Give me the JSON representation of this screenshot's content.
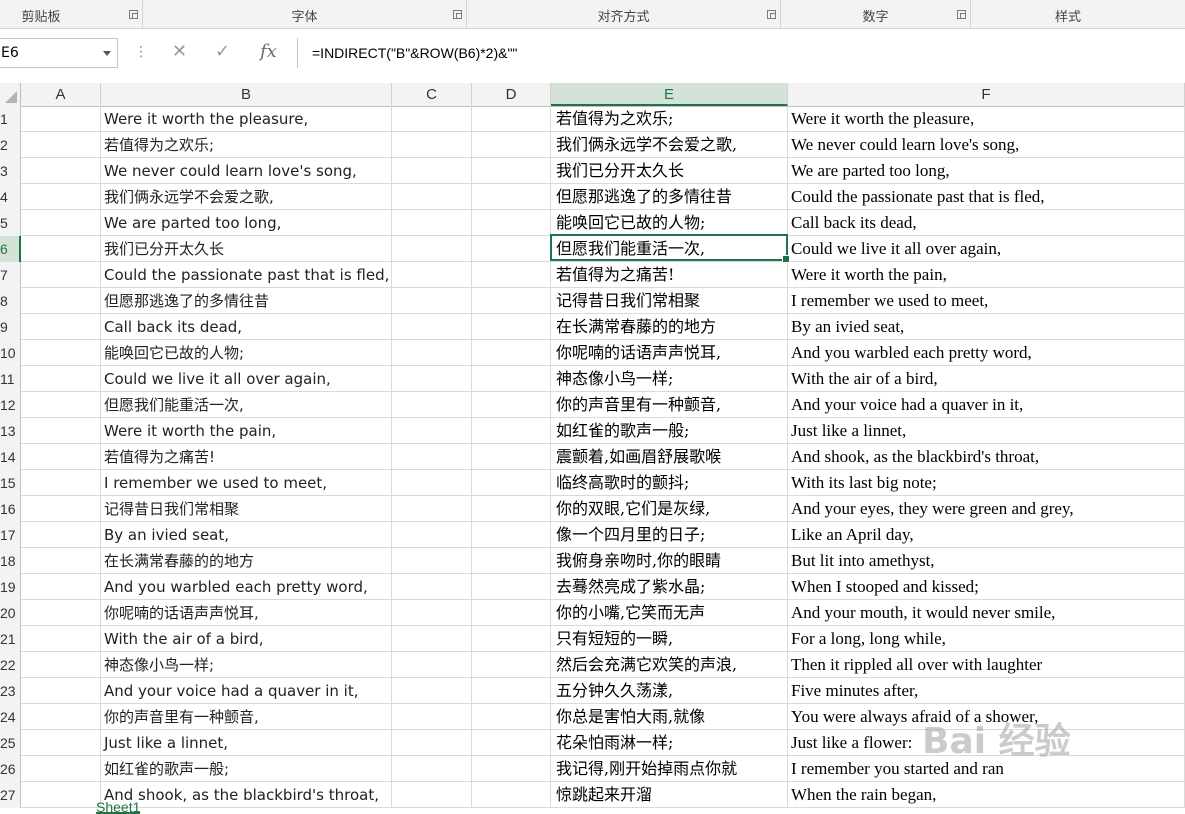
{
  "ribbon": {
    "groups": [
      "剪贴板",
      "字体",
      "对齐方式",
      "数字",
      "样式"
    ]
  },
  "formula_bar": {
    "name_box": "E6",
    "formula": "=INDIRECT(\"B\"&ROW(B6)*2)&\"\""
  },
  "columns": [
    "A",
    "B",
    "C",
    "D",
    "E",
    "F"
  ],
  "selected_column": "E",
  "rows": [
    {
      "n": "1",
      "B": "Were it worth the pleasure,",
      "E": "若值得为之欢乐;",
      "F": "Were it worth the pleasure,"
    },
    {
      "n": "2",
      "B": "若值得为之欢乐;",
      "E": "我们俩永远学不会爱之歌,",
      "F": "We never could learn love's song,"
    },
    {
      "n": "3",
      "B": "We never could learn love's song,",
      "E": "我们已分开太久长",
      "F": "We are parted too long,"
    },
    {
      "n": "4",
      "B": "我们俩永远学不会爱之歌,",
      "E": "但愿那逃逸了的多情往昔",
      "F": "Could the passionate past that is fled,"
    },
    {
      "n": "5",
      "B": "We are parted too long,",
      "E": "能唤回它已故的人物;",
      "F": "Call back its dead,"
    },
    {
      "n": "6",
      "B": "我们已分开太久长",
      "E": "但愿我们能重活一次,",
      "F": "Could we live it all over again,"
    },
    {
      "n": "7",
      "B": "Could the passionate past that is fled,",
      "E": "若值得为之痛苦!",
      "F": "Were it worth the pain,"
    },
    {
      "n": "8",
      "B": "但愿那逃逸了的多情往昔",
      "E": "记得昔日我们常相聚",
      "F": "I remember we used to meet,"
    },
    {
      "n": "9",
      "B": "Call back its dead,",
      "E": "在长满常春藤的的地方",
      "F": "By an ivied seat,"
    },
    {
      "n": "10",
      "B": "能唤回它已故的人物;",
      "E": "你呢喃的话语声声悦耳,",
      "F": "And you warbled each pretty word,"
    },
    {
      "n": "11",
      "B": "Could we live it all over again,",
      "E": "神态像小鸟一样;",
      "F": "With the air of a bird,"
    },
    {
      "n": "12",
      "B": "但愿我们能重活一次,",
      "E": "你的声音里有一种颤音,",
      "F": "And your voice had a quaver in it,"
    },
    {
      "n": "13",
      "B": "Were it worth the pain,",
      "E": "如红雀的歌声一般;",
      "F": "Just like a linnet,"
    },
    {
      "n": "14",
      "B": "若值得为之痛苦!",
      "E": "震颤着,如画眉舒展歌喉",
      "F": "And shook, as the blackbird's throat,"
    },
    {
      "n": "15",
      "B": "I remember we used to meet,",
      "E": "临终高歌时的颤抖;",
      "F": "With its last big note;"
    },
    {
      "n": "16",
      "B": "记得昔日我们常相聚",
      "E": "你的双眼,它们是灰绿,",
      "F": "And your eyes, they were green and grey,"
    },
    {
      "n": "17",
      "B": "By an ivied seat,",
      "E": "像一个四月里的日子;",
      "F": "Like an April day,"
    },
    {
      "n": "18",
      "B": "在长满常春藤的的地方",
      "E": "我俯身亲吻时,你的眼睛",
      "F": "But lit into amethyst,"
    },
    {
      "n": "19",
      "B": "And you warbled each pretty word,",
      "E": "去蓦然亮成了紫水晶;",
      "F": "When I stooped and kissed;"
    },
    {
      "n": "20",
      "B": "你呢喃的话语声声悦耳,",
      "E": "你的小嘴,它笑而无声",
      "F": "And your mouth, it would never smile,"
    },
    {
      "n": "21",
      "B": "With the air of a bird,",
      "E": "只有短短的一瞬,",
      "F": "For a long, long while,"
    },
    {
      "n": "22",
      "B": "神态像小鸟一样;",
      "E": "然后会充满它欢笑的声浪,",
      "F": "Then it rippled all over with laughter"
    },
    {
      "n": "23",
      "B": "And your voice had a quaver in it,",
      "E": "五分钟久久荡漾,",
      "F": "Five minutes after,"
    },
    {
      "n": "24",
      "B": "你的声音里有一种颤音,",
      "E": "你总是害怕大雨,就像",
      "F": "You were always afraid of a shower,"
    },
    {
      "n": "25",
      "B": "Just like a linnet,",
      "E": "花朵怕雨淋一样;",
      "F": "Just like a flower:"
    },
    {
      "n": "26",
      "B": "如红雀的歌声一般;",
      "E": "我记得,刚开始掉雨点你就",
      "F": "I remember you started and ran"
    },
    {
      "n": "27",
      "B": "And shook, as the blackbird's throat,",
      "E": "惊跳起来开溜",
      "F": "When the rain began,"
    }
  ],
  "sheet_tab": "Sheet1",
  "watermark": "Bai 经验",
  "colors": {
    "accent": "#217346",
    "header_bg": "#f3f3f3",
    "gridline": "#dadada"
  }
}
